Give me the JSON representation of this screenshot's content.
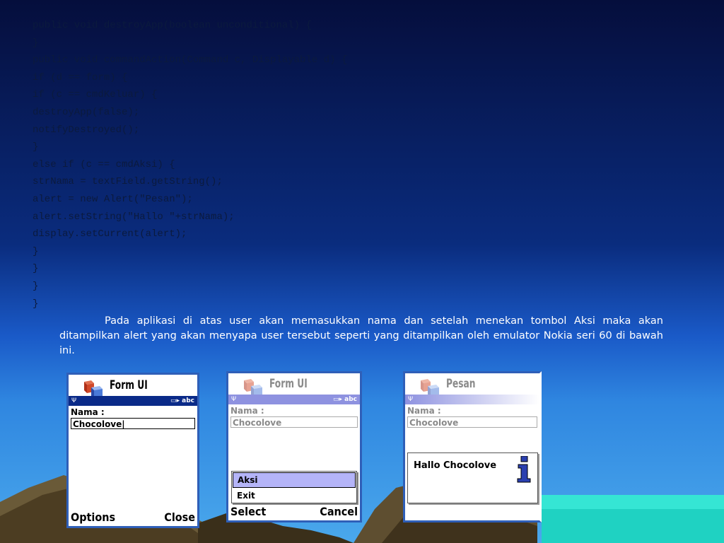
{
  "code_lines": [
    "public void destroyApp(boolean unconditional) {",
    "}",
    "public void commandAction(Command c, Displayable d) {",
    "if (d == form) {",
    "if (c == cmdKeluar) {",
    "destroyApp(false);",
    "notifyDestroyed();",
    "}",
    "else if (c == cmdAksi) {",
    "strNama = textField.getString();",
    "alert = new Alert(\"Pesan\");",
    "alert.setString(\"Hallo \"+strNama);",
    "display.setCurrent(alert);",
    "}",
    "}",
    "}",
    "}"
  ],
  "paragraph": "Pada aplikasi di atas user akan memasukkan nama dan setelah menekan tombol Aksi maka akan ditampilkan alert yang akan menyapa user tersebut seperti yang ditampilkan oleh emulator Nokia seri 60 di bawah ini.",
  "screen1": {
    "title": "Form UI",
    "status_mode": "abc",
    "field_label": "Nama :",
    "field_value": "Chocolove|",
    "left_soft": "Options",
    "right_soft": "Close"
  },
  "screen2": {
    "title": "Form UI",
    "status_mode": "abc",
    "field_label": "Nama :",
    "field_value": "Chocolove",
    "menu_items": [
      "Aksi",
      "Exit"
    ],
    "left_soft": "Select",
    "right_soft": "Cancel"
  },
  "screen3": {
    "title": "Pesan",
    "field_label": "Nama :",
    "field_value": "Chocolove",
    "alert_text": "Hallo Chocolove"
  },
  "colors": {
    "status_bar_active": "#0a2a88",
    "status_bar_dim": "#8e92e0",
    "menu_selected": "#b4b4f8",
    "phone_border": "#2f5fb8"
  }
}
